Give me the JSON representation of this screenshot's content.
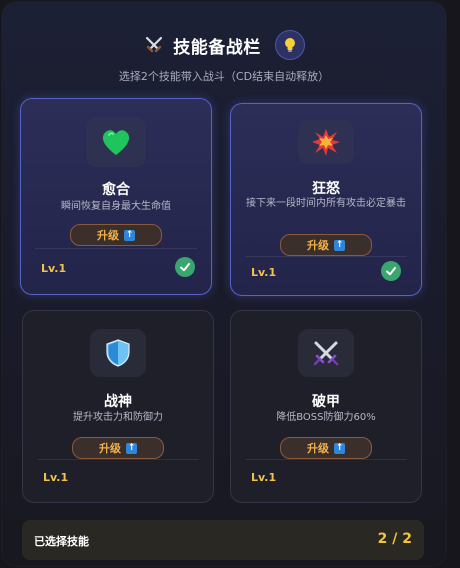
{
  "header": {
    "title": "技能备战栏",
    "title_icon": "crossed-swords-icon",
    "hint_icon": "lightbulb-icon",
    "subtitle": "选择2个技能带入战斗（CD结束自动释放）"
  },
  "skills": [
    {
      "name": "愈合",
      "desc": "瞬间恢复自身最大生命值",
      "upgrade_label": "升级",
      "level": "Lv.1",
      "selected": true,
      "icon": "green-heart-icon"
    },
    {
      "name": "狂怒",
      "desc": "接下来一段时间内所有攻击必定暴击",
      "upgrade_label": "升级",
      "level": "Lv.1",
      "selected": true,
      "icon": "explosion-icon"
    },
    {
      "name": "战神",
      "desc": "提升攻击力和防御力",
      "upgrade_label": "升级",
      "level": "Lv.1",
      "selected": false,
      "icon": "shield-icon"
    },
    {
      "name": "破甲",
      "desc": "降低BOSS防御力60%",
      "upgrade_label": "升级",
      "level": "Lv.1",
      "selected": false,
      "icon": "crossed-swords-icon"
    }
  ],
  "footer": {
    "label": "已选择技能",
    "count": "2 / 2"
  },
  "colors": {
    "accent_gold": "#f2c24a",
    "selected_border": "#5563c6",
    "check_green": "#3aa56f"
  }
}
